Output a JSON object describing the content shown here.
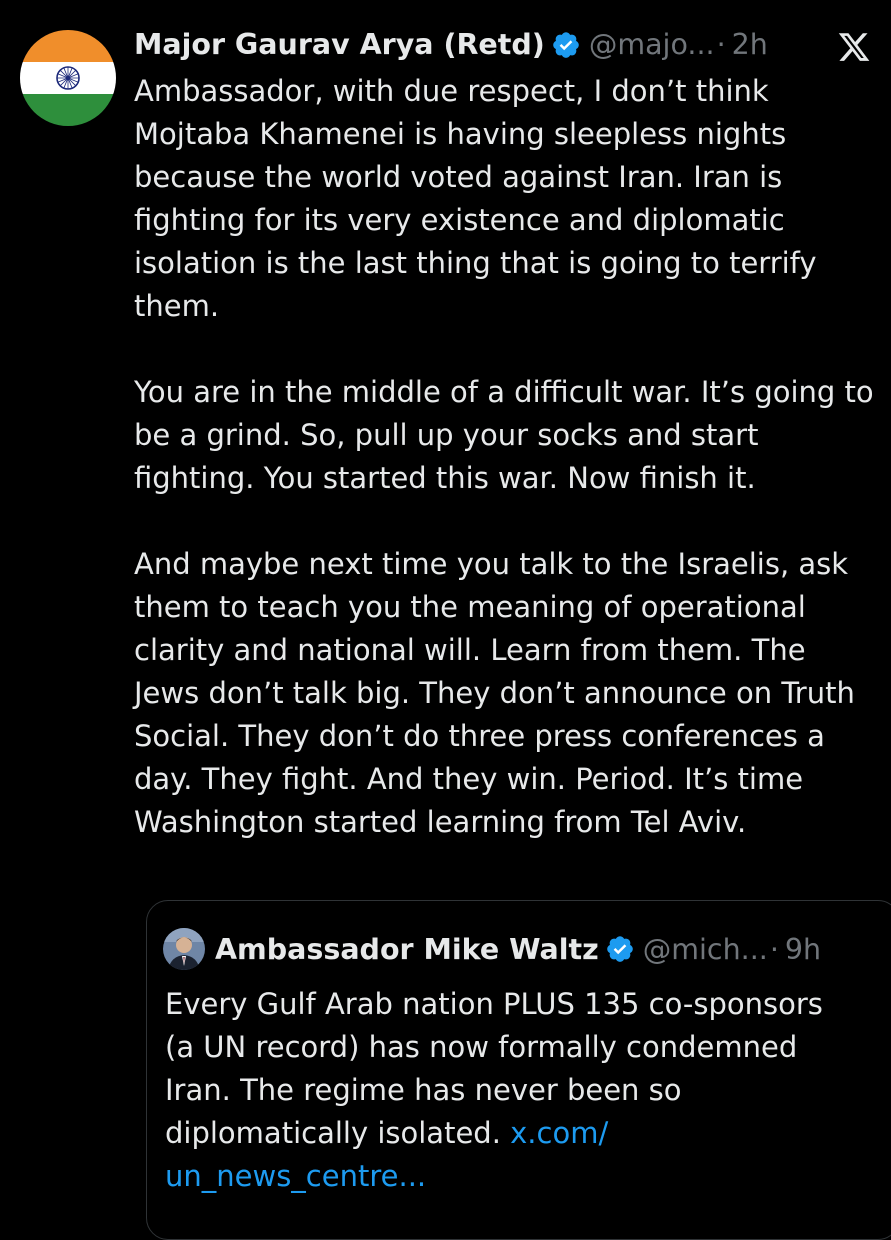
{
  "post": {
    "author_name": "Major Gaurav Arya (Retd)",
    "handle": "@majo...",
    "separator": "·",
    "time": "2h",
    "paragraphs": [
      "Ambassador, with due respect, I don’t think Mojtaba Khamenei is having sleepless nights because the world voted against Iran. Iran is fighting for its very existence and diplomatic isolation is the last thing that is going to terrify them.",
      "You are in the middle of a difficult war. It’s going to be a grind. So, pull up your socks and start fighting. You started this war. Now finish it.",
      "And maybe next time you talk to the Israelis, ask them to teach you the meaning of operational clarity and national will. Learn from them. The Jews don’t talk big. They don’t announce on Truth Social. They don’t do three press conferences a day. They fight. And they win. Period. It’s time Washington started learning from Tel Aviv."
    ]
  },
  "quoted": {
    "author_name": "Ambassador Mike Waltz",
    "handle": "@mich...",
    "separator": "·",
    "time": "9h",
    "text": "Every Gulf Arab nation PLUS 135 co-sponsors (a UN record) has now formally condemned Iran. The regime has never been so diplomatically isolated.",
    "link": "x.com/ un_news_centre..."
  },
  "icons": {
    "avatar": "india-flag-avatar",
    "verified": "verified-badge-icon",
    "brand": "x-logo-icon"
  },
  "colors": {
    "background": "#000000",
    "text": "#e7e9ea",
    "muted": "#71767b",
    "link": "#1d9bf0",
    "verified": "#1d9bf0",
    "border": "#2f3336"
  }
}
